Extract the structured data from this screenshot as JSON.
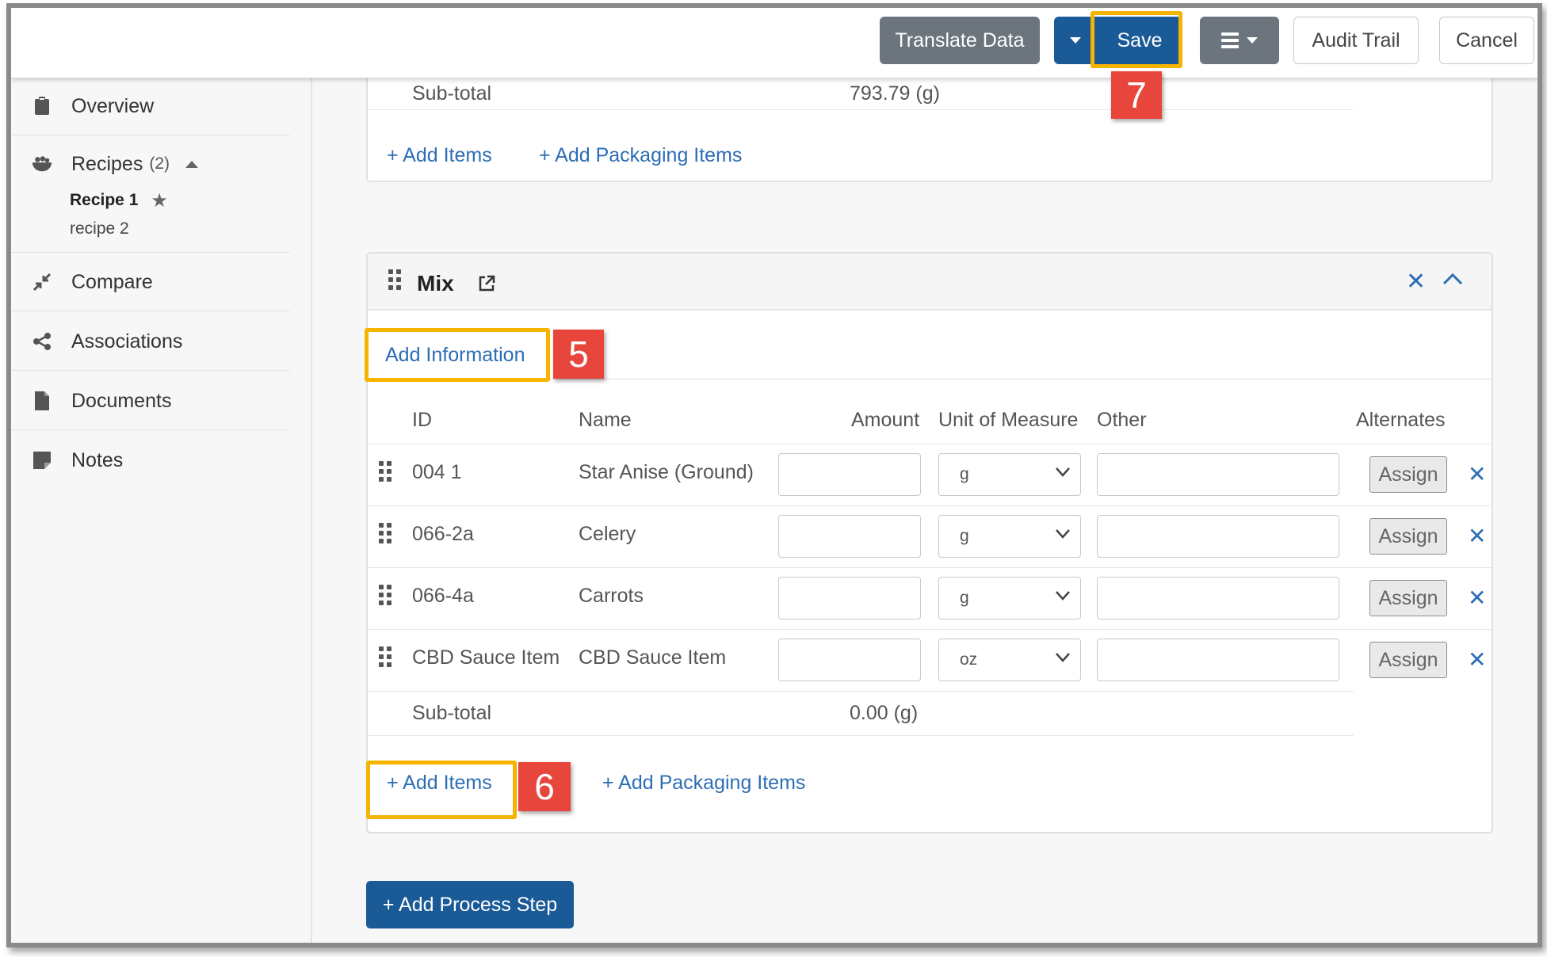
{
  "toolbar": {
    "translate_label": "Translate Data",
    "save_label": "Save",
    "audit_label": "Audit Trail",
    "cancel_label": "Cancel"
  },
  "annotations": {
    "save": "7",
    "add_information": "5",
    "add_items": "6"
  },
  "sidebar": {
    "overview": "Overview",
    "recipes": "Recipes",
    "recipes_count": "(2)",
    "recipe1": "Recipe 1",
    "recipe2": "recipe 2",
    "compare": "Compare",
    "associations": "Associations",
    "documents": "Documents",
    "notes": "Notes"
  },
  "top_section": {
    "subtotal_label": "Sub-total",
    "subtotal_value": "793.79 (g)",
    "add_items": "+ Add Items",
    "add_packaging": "+ Add Packaging Items"
  },
  "mix": {
    "title": "Mix",
    "add_information": "Add Information",
    "headers": {
      "id": "ID",
      "name": "Name",
      "amount": "Amount",
      "uom": "Unit of Measure",
      "other": "Other",
      "alternates": "Alternates"
    },
    "rows": [
      {
        "id": "004 1",
        "name": "Star Anise (Ground)",
        "uom": "g",
        "assign": "Assign"
      },
      {
        "id": "066-2a",
        "name": "Celery",
        "uom": "g",
        "assign": "Assign"
      },
      {
        "id": "066-4a",
        "name": "Carrots",
        "uom": "g",
        "assign": "Assign"
      },
      {
        "id": "CBD Sauce Item",
        "name": "CBD Sauce Item",
        "uom": "oz",
        "assign": "Assign"
      }
    ],
    "subtotal_label": "Sub-total",
    "subtotal_value": "0.00 (g)",
    "add_items": "+ Add Items",
    "add_packaging": "+ Add Packaging Items"
  },
  "add_process_step": "+ Add Process Step",
  "colors": {
    "primary": "#1a5a96",
    "link": "#2c6db5",
    "highlight": "#f5b400",
    "badge": "#e8453c",
    "gray_button": "#6c757d"
  }
}
